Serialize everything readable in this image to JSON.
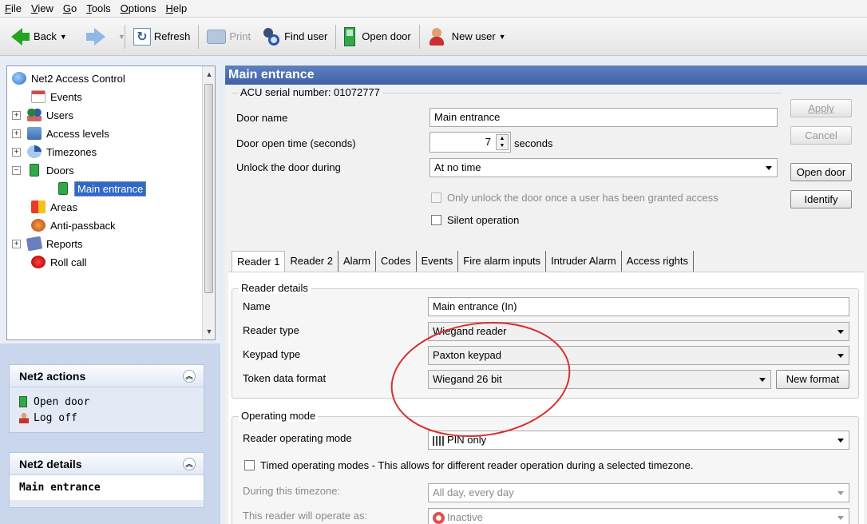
{
  "menu": [
    {
      "key": "F",
      "rest": "ile"
    },
    {
      "key": "V",
      "rest": "iew"
    },
    {
      "key": "G",
      "rest": "o"
    },
    {
      "key": "T",
      "rest": "ools"
    },
    {
      "key": "O",
      "rest": "ptions"
    },
    {
      "key": "H",
      "rest": "elp"
    }
  ],
  "toolbar": {
    "back": "Back",
    "refresh": "Refresh",
    "print": "Print",
    "find_user": "Find user",
    "open_door": "Open door",
    "new_user": "New user"
  },
  "tree": {
    "root": "Net2 Access Control",
    "events": "Events",
    "users": "Users",
    "access_levels": "Access levels",
    "timezones": "Timezones",
    "doors": "Doors",
    "main_entrance": "Main entrance",
    "areas": "Areas",
    "anti_passback": "Anti-passback",
    "reports": "Reports",
    "roll_call": "Roll call"
  },
  "actions_panel": {
    "title": "Net2 actions",
    "open_door": "Open door",
    "log_off": "Log off"
  },
  "details_panel": {
    "title": "Net2 details",
    "value": "Main entrance"
  },
  "header": {
    "title": "Main entrance"
  },
  "acu": {
    "legend": "ACU serial number: 01072777",
    "door_name_label": "Door name",
    "door_name_value": "Main entrance",
    "open_time_label": "Door open time (seconds)",
    "open_time_value": "7",
    "open_time_unit": "seconds",
    "unlock_label": "Unlock the door during",
    "unlock_value": "At no time",
    "only_unlock_label": "Only unlock the door once a user has been granted access",
    "silent_label": "Silent operation"
  },
  "buttons": {
    "apply": "Apply",
    "cancel": "Cancel",
    "open_door": "Open door",
    "identify": "Identify",
    "new_format": "New format"
  },
  "tabs": [
    "Reader 1",
    "Reader 2",
    "Alarm",
    "Codes",
    "Events",
    "Fire alarm inputs",
    "Intruder Alarm",
    "Access rights"
  ],
  "reader_details": {
    "legend": "Reader details",
    "name_label": "Name",
    "name_value": "Main entrance (In)",
    "reader_type_label": "Reader type",
    "reader_type_value": "Wiegand reader",
    "keypad_type_label": "Keypad type",
    "keypad_type_value": "Paxton keypad",
    "token_format_label": "Token data format",
    "token_format_value": "Wiegand 26 bit"
  },
  "operating_mode": {
    "legend": "Operating mode",
    "mode_label": "Reader operating mode",
    "mode_value": "PIN only",
    "timed_label": "Timed operating modes - This allows for different reader operation during a selected timezone.",
    "timezone_label": "During this timezone:",
    "timezone_value": "All day, every day",
    "operate_as_label": "This reader will operate as:",
    "operate_as_value": "Inactive"
  },
  "colors": {
    "header_blue": "#4a6cb0",
    "annotation_red": "#d83030",
    "selection_blue": "#3169c6"
  }
}
